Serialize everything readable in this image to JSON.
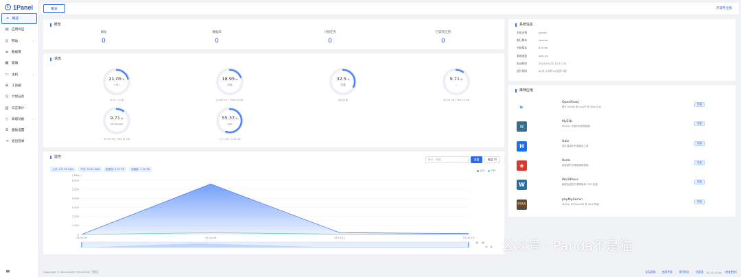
{
  "app": {
    "logo_text": "1Panel",
    "logo_mark": "1"
  },
  "sidebar": {
    "items": [
      {
        "label": "概览",
        "icon": "home-icon",
        "glyph": "⌂",
        "active": true,
        "arrow": ""
      },
      {
        "label": "应用商店",
        "icon": "store-icon",
        "glyph": "▤",
        "active": false,
        "arrow": ""
      },
      {
        "label": "网站",
        "icon": "globe-icon",
        "glyph": "◎",
        "active": false,
        "arrow": "⌄"
      },
      {
        "label": "数据库",
        "icon": "database-icon",
        "glyph": "≡",
        "active": false,
        "arrow": ""
      },
      {
        "label": "容器",
        "icon": "container-icon",
        "glyph": "▦",
        "active": false,
        "arrow": ""
      },
      {
        "label": "主机",
        "icon": "host-icon",
        "glyph": "▭",
        "active": false,
        "arrow": "⌄"
      },
      {
        "label": "工具箱",
        "icon": "toolbox-icon",
        "glyph": "⊞",
        "active": false,
        "arrow": ""
      },
      {
        "label": "计划任务",
        "icon": "cron-icon",
        "glyph": "◷",
        "active": false,
        "arrow": ""
      },
      {
        "label": "日志审计",
        "icon": "log-icon",
        "glyph": "▥",
        "active": false,
        "arrow": ""
      },
      {
        "label": "高级功能",
        "icon": "diamond-icon",
        "glyph": "◇",
        "active": false,
        "arrow": "⌄"
      },
      {
        "label": "面板设置",
        "icon": "gear-icon",
        "glyph": "⚙",
        "active": false,
        "arrow": ""
      },
      {
        "label": "退出登录",
        "icon": "logout-icon",
        "glyph": "⇥",
        "active": false,
        "arrow": ""
      }
    ],
    "menu_toggle": "≡"
  },
  "topbar": {
    "tab_label": "概览",
    "upgrade_label": "升级专业版"
  },
  "overview": {
    "title": "概览",
    "items": [
      {
        "label": "网站",
        "value": "0"
      },
      {
        "label": "数据库",
        "value": "0"
      },
      {
        "label": "计划任务",
        "value": "0"
      },
      {
        "label": "已安装应用",
        "value": "0"
      }
    ]
  },
  "status": {
    "title": "状态",
    "gauges": [
      {
        "value": "21.05",
        "unit": "%",
        "label": "CPU",
        "sub": "(0.87 / 4) 核",
        "percent": 21.05
      },
      {
        "value": "18.95",
        "unit": "%",
        "label": "内存",
        "sub": "(1460.50 / 7858.0) MB",
        "percent": 18.95
      },
      {
        "value": "32.5",
        "unit": "%",
        "label": "负载",
        "sub": "运行正常",
        "percent": 32.5
      },
      {
        "value": "9.71",
        "unit": "%",
        "label": "/",
        "sub": "35.06 GB / 383.41 GB",
        "percent": 9.71
      },
      {
        "value": "9.71",
        "unit": "%",
        "label": "/etc/hosts",
        "sub": "35.06 GB / 383.41 GB",
        "percent": 9.71
      },
      {
        "value": "55.37",
        "unit": "%",
        "label": "/opt",
        "sub": "1.17 GB / 2.28 GB",
        "percent": 55.37
      }
    ]
  },
  "traffic": {
    "title": "监控",
    "search_placeholder": "网卡 · 网络",
    "btn_primary": "流量",
    "btn_secondary": "磁盘 IO",
    "pills": [
      "上行: 117.95 KB/s",
      "下行: 31.61 KB/s",
      "总发送: 2.57 TB",
      "总接收: 1.24 TB"
    ],
    "legend": {
      "up": "上行",
      "down": "下行",
      "up_color": "#5b8ff9",
      "down_color": "#5ad8a6"
    }
  },
  "chart_data": {
    "type": "area",
    "ylabel": "( KB/s )",
    "yticks": [
      "0",
      "1,000",
      "2,000",
      "3,000",
      "4,000",
      "5,000",
      "6,000"
    ],
    "ylim": [
      0,
      6000
    ],
    "x": [
      "23:10:05",
      "23:10:08",
      "23:10:11",
      "23:10:14"
    ],
    "series": [
      {
        "name": "上行",
        "values": [
          0,
          5600,
          200,
          100
        ]
      },
      {
        "name": "下行",
        "values": [
          0,
          200,
          40,
          20
        ]
      }
    ]
  },
  "sysinfo": {
    "title": "系统信息",
    "rows": [
      {
        "key": "主机名称",
        "value": "panda"
      },
      {
        "key": "发行版本",
        "value": "ubuntu"
      },
      {
        "key": "内核版本",
        "value": "6.5.0m"
      },
      {
        "key": "系统类型",
        "value": "x86_64"
      },
      {
        "key": "启动时间",
        "value": "2024-04-03 10:17:42"
      },
      {
        "key": "运行时间",
        "value": "61天 2小时 50分钟 3秒"
      }
    ]
  },
  "apps": {
    "title": "推荐应用",
    "items": [
      {
        "name": "OpenResty",
        "desc": "基于 NGINX 和 LuaJIT 的 Web 平台",
        "btn": "安装",
        "icon": "openresty-icon",
        "glyph": "🐦",
        "bg": "#ffffff",
        "fg": "#3fa34d"
      },
      {
        "name": "MySQL",
        "desc": "MySQL 开源关系型数据库",
        "btn": "安装",
        "icon": "mysql-icon",
        "glyph": "≈",
        "bg": "#3a6d8c",
        "fg": "#ffffff"
      },
      {
        "name": "Halo",
        "desc": "强大易用的开源建站工具",
        "btn": "安装",
        "icon": "halo-icon",
        "glyph": "H",
        "bg": "#1d6fe8",
        "fg": "#ffffff"
      },
      {
        "name": "Redis",
        "desc": "高性能的开源键值数据库",
        "btn": "安装",
        "icon": "redis-icon",
        "glyph": "◈",
        "bg": "#d63a2f",
        "fg": "#ffffff"
      },
      {
        "name": "WordPress",
        "desc": "最受欢迎的开源博客和 CMS 系统",
        "btn": "安装",
        "icon": "wordpress-icon",
        "glyph": "W",
        "bg": "#2c6f9c",
        "fg": "#ffffff"
      },
      {
        "name": "phpMyAdmin",
        "desc": "MySQL 和 MariaDB 的 Web 界面",
        "btn": "安装",
        "icon": "phpmyadmin-icon",
        "glyph": "PMA",
        "bg": "#5a4a3a",
        "fg": "#f0a030"
      }
    ]
  },
  "footer": {
    "copyright": "Copyright © 2014-2024 FIT2CLOUD 飞致云",
    "links": [
      "论坛求助",
      "使用手册",
      "项目地址",
      "社区版"
    ],
    "version": "v1.10.10-lts",
    "version_note": "(检查更新)"
  },
  "watermark": {
    "text": "公众号 · Panda不是猫"
  }
}
